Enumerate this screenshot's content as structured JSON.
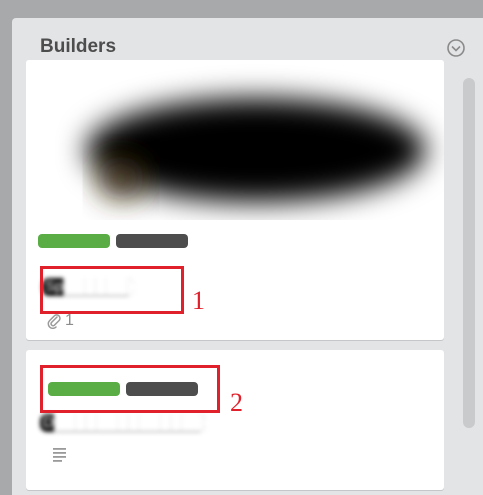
{
  "list": {
    "title": "Builders",
    "menu_icon": "chevron-down-circle-icon"
  },
  "cards": [
    {
      "title": "Sp███████",
      "labels": [
        {
          "color": "#5aac44"
        },
        {
          "color": "#4d4d4d"
        }
      ],
      "attachments_count": "1",
      "badge_icon": "paperclip-icon",
      "has_cover": true
    },
    {
      "title": "D████████████████",
      "labels": [
        {
          "color": "#5aac44"
        },
        {
          "color": "#4d4d4d"
        }
      ],
      "badge_icon": "description-icon"
    }
  ],
  "annotations": [
    {
      "number": "1"
    },
    {
      "number": "2"
    }
  ],
  "colors": {
    "board_bg": "#a8a9ab",
    "list_bg": "#e3e4e6",
    "callout": "#e0212b"
  }
}
